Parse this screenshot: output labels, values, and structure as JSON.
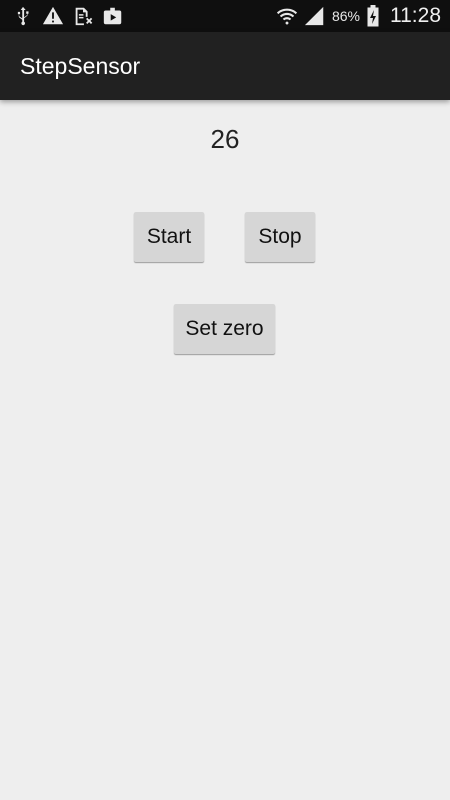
{
  "status_bar": {
    "left_icons": [
      "usb-icon",
      "warning-icon",
      "sim-off-icon",
      "media-icon"
    ],
    "right_icons": [
      "wifi-icon",
      "signal-icon",
      "battery-charging-icon"
    ],
    "battery_percent": "86%",
    "time": "11:28"
  },
  "app_bar": {
    "title": "StepSensor"
  },
  "main": {
    "step_count": "26",
    "buttons": {
      "start": "Start",
      "stop": "Stop",
      "set_zero": "Set zero"
    }
  },
  "colors": {
    "status_bar_bg": "#0f0f0f",
    "app_bar_bg": "#212121",
    "content_bg": "#eeeeee",
    "button_bg": "#d6d6d6"
  }
}
